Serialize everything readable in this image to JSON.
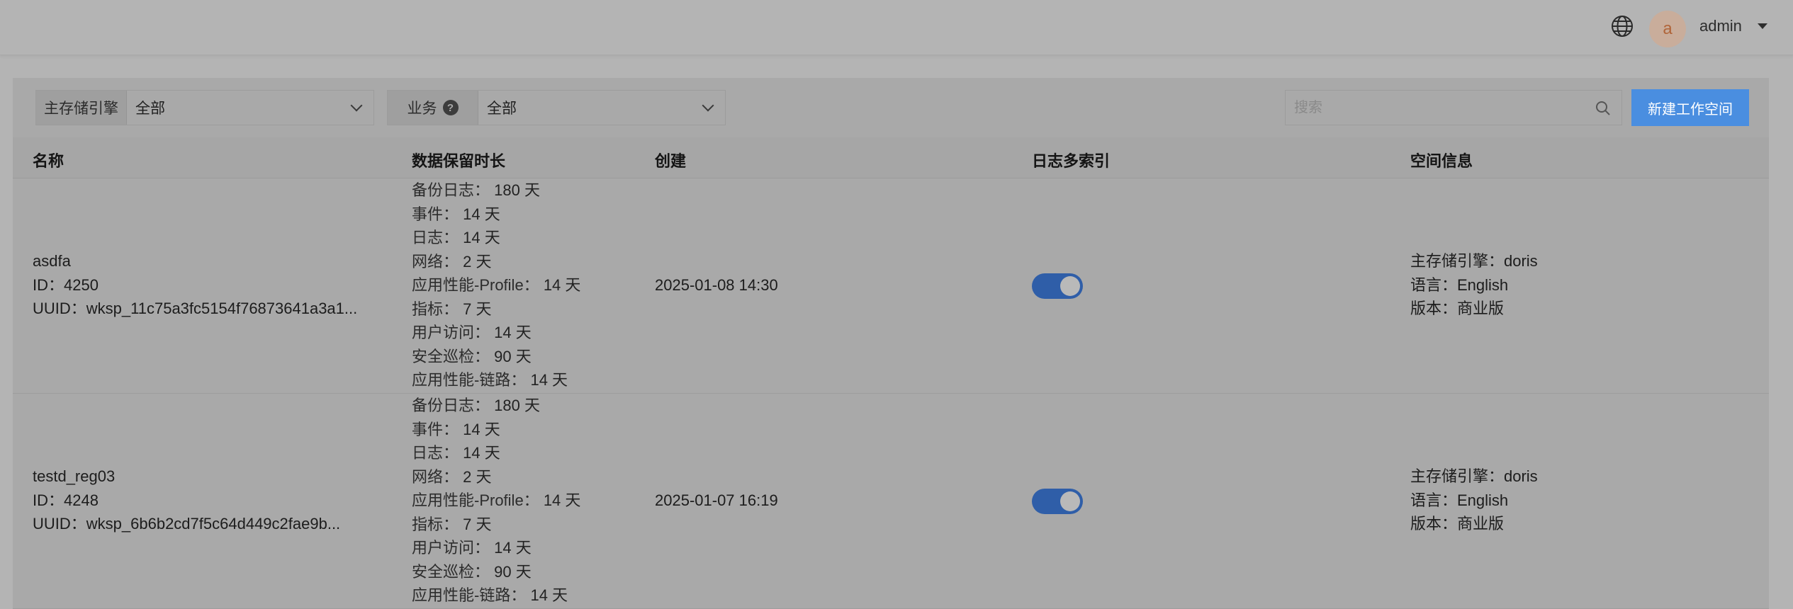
{
  "header": {
    "user_avatar_letter": "a",
    "user_name": "admin"
  },
  "filters": {
    "storage_engine": {
      "label": "主存储引擎",
      "value": "全部"
    },
    "business": {
      "label": "业务",
      "value": "全部"
    }
  },
  "search": {
    "placeholder": "搜索"
  },
  "buttons": {
    "new_workspace": "新建工作空间"
  },
  "table": {
    "columns": [
      "名称",
      "数据保留时长",
      "创建",
      "日志多索引",
      "空间信息"
    ],
    "rows": [
      {
        "name": "asdfa",
        "id": "ID：4250",
        "uuid": "UUID：wksp_11c75a3fc5154f76873641a3a1...",
        "retention": [
          {
            "label": "备份日志：",
            "value": "180 天"
          },
          {
            "label": "事件：",
            "value": "14 天"
          },
          {
            "label": "日志：",
            "value": "14 天"
          },
          {
            "label": "网络：",
            "value": "2 天"
          },
          {
            "label": "应用性能-Profile：",
            "value": "14 天"
          },
          {
            "label": "指标：",
            "value": "7 天"
          },
          {
            "label": "用户访问：",
            "value": "14 天"
          },
          {
            "label": "安全巡检：",
            "value": "90 天"
          },
          {
            "label": "应用性能-链路：",
            "value": "14 天"
          }
        ],
        "created": "2025-01-08 14:30",
        "multi_index_enabled": true,
        "info": [
          "主存储引擎：doris",
          "语言：English",
          "版本：商业版"
        ]
      },
      {
        "name": "testd_reg03",
        "id": "ID：4248",
        "uuid": "UUID：wksp_6b6b2cd7f5c64d449c2fae9b...",
        "retention": [
          {
            "label": "备份日志：",
            "value": "180 天"
          },
          {
            "label": "事件：",
            "value": "14 天"
          },
          {
            "label": "日志：",
            "value": "14 天"
          },
          {
            "label": "网络：",
            "value": "2 天"
          },
          {
            "label": "应用性能-Profile：",
            "value": "14 天"
          },
          {
            "label": "指标：",
            "value": "7 天"
          },
          {
            "label": "用户访问：",
            "value": "14 天"
          },
          {
            "label": "安全巡检：",
            "value": "90 天"
          },
          {
            "label": "应用性能-链路：",
            "value": "14 天"
          }
        ],
        "created": "2025-01-07 16:19",
        "multi_index_enabled": true,
        "info": [
          "主存储引擎：doris",
          "语言：English",
          "版本：商业版"
        ]
      }
    ]
  }
}
